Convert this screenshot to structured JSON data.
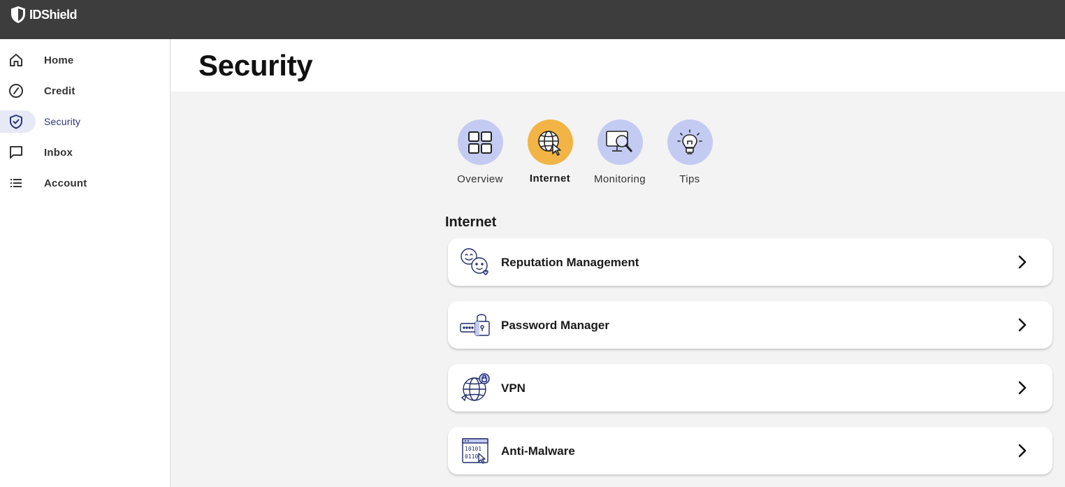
{
  "brand": {
    "name": "IDShield"
  },
  "sidebar": {
    "items": [
      {
        "label": "Home",
        "icon": "home-icon"
      },
      {
        "label": "Credit",
        "icon": "gauge-icon"
      },
      {
        "label": "Security",
        "icon": "shield-check-icon",
        "active": true
      },
      {
        "label": "Inbox",
        "icon": "message-icon"
      },
      {
        "label": "Account",
        "icon": "list-icon"
      }
    ]
  },
  "page": {
    "title": "Security"
  },
  "tabs": [
    {
      "label": "Overview",
      "icon": "grid-icon"
    },
    {
      "label": "Internet",
      "icon": "globe-cursor-icon",
      "active": true
    },
    {
      "label": "Monitoring",
      "icon": "monitor-search-icon"
    },
    {
      "label": "Tips",
      "icon": "lightbulb-icon"
    }
  ],
  "section": {
    "title": "Internet"
  },
  "cards": [
    {
      "label": "Reputation Management",
      "icon": "faces-icon"
    },
    {
      "label": "Password Manager",
      "icon": "password-lock-icon"
    },
    {
      "label": "VPN",
      "icon": "globe-lock-icon"
    },
    {
      "label": "Anti-Malware",
      "icon": "binary-screen-icon"
    }
  ],
  "colors": {
    "topbar": "#3d3d3d",
    "active_tab": "#f2b445",
    "tab_circle": "#c4cbf3",
    "nav_active_bg": "#e7e9f7",
    "nav_active_text": "#2a3576",
    "content_bg": "#f3f3f3"
  }
}
